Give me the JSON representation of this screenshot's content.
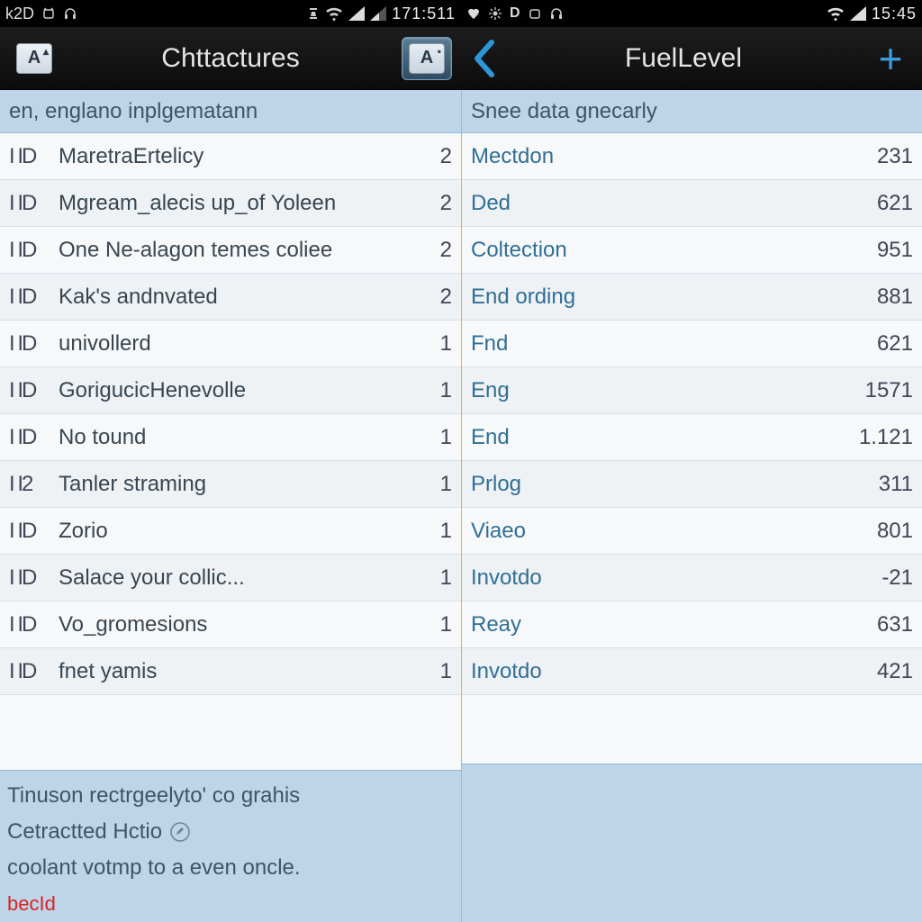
{
  "left": {
    "status": {
      "prefix": "k2D",
      "clock": "171:511"
    },
    "title": "Chttactures",
    "section_header": "en, englano inplgematann",
    "rows": [
      {
        "id": "I ID",
        "label": "MaretraErtelicy",
        "count": "2"
      },
      {
        "id": "I ID",
        "label": "Mgream_alecis up_of Yoleen",
        "count": "2"
      },
      {
        "id": "I ID",
        "label": "One Ne-alagon temes coliee",
        "count": "2"
      },
      {
        "id": "I ID",
        "label": "Kak's andnvated",
        "count": "2"
      },
      {
        "id": "I ID",
        "label": "univollerd",
        "count": "1"
      },
      {
        "id": "I ID",
        "label": "GorigucicHenevolle",
        "count": "1"
      },
      {
        "id": "I ID",
        "label": "No tound",
        "count": "1"
      },
      {
        "id": "I I2",
        "label": "Tanler straming",
        "count": "1"
      },
      {
        "id": "I ID",
        "label": "Zorio",
        "count": "1"
      },
      {
        "id": "I ID",
        "label": "Salace your collic...",
        "count": "1"
      },
      {
        "id": "I ID",
        "label": "Vo_gromesions",
        "count": "1"
      },
      {
        "id": "I ID",
        "label": "fnet yamis",
        "count": "1"
      }
    ],
    "footer": {
      "line1": "Tinuson rectrgeelyto' co grahis",
      "line2": "Cetractted Hctio",
      "line3": "coolant votmp to a even oncle.",
      "alert": "becId"
    }
  },
  "right": {
    "status": {
      "clock": "15:45"
    },
    "title": "FuelLevel",
    "section_header": "Snee data gnecarly",
    "rows": [
      {
        "label": "Mectdon",
        "value": "231"
      },
      {
        "label": "Ded",
        "value": "621"
      },
      {
        "label": "Coltection",
        "value": "951"
      },
      {
        "label": "End ording",
        "value": "881"
      },
      {
        "label": "Fnd",
        "value": "621"
      },
      {
        "label": "Eng",
        "value": "1571"
      },
      {
        "label": "End",
        "value": "1.121"
      },
      {
        "label": "Prlog",
        "value": "311"
      },
      {
        "label": "Viaeo",
        "value": "801"
      },
      {
        "label": "Invotdo",
        "value": "-21"
      },
      {
        "label": "Reay",
        "value": "631"
      },
      {
        "label": "Invotdo",
        "value": "421"
      }
    ]
  },
  "icons": {
    "a_badge": "A"
  }
}
